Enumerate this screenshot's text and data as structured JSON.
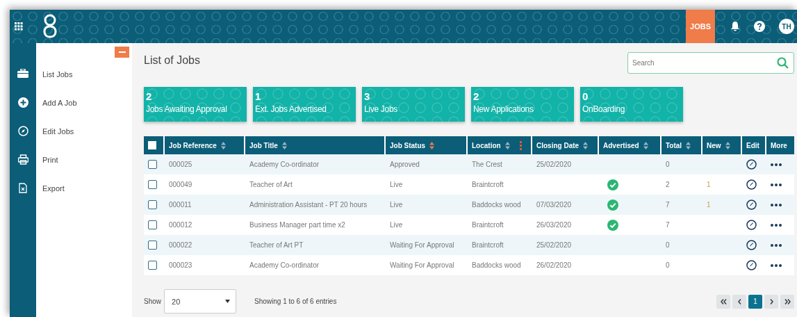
{
  "top_bar": {
    "active_module": {
      "label": "JOBS",
      "selected": true
    },
    "avatar": "TH"
  },
  "sidebar": {
    "items": [
      {
        "label": "List Jobs"
      },
      {
        "label": "Add A Job"
      },
      {
        "label": "Edit Jobs"
      },
      {
        "label": "Print"
      },
      {
        "label": "Export"
      }
    ]
  },
  "page_title": "List of Jobs",
  "search": {
    "placeholder": "Search"
  },
  "stats": [
    {
      "count": "2",
      "label": "Jobs Awaiting Approval"
    },
    {
      "count": "1",
      "label": "Ext. Jobs Advertised"
    },
    {
      "count": "3",
      "label": "Live Jobs"
    },
    {
      "count": "2",
      "label": "New Applications"
    },
    {
      "count": "0",
      "label": "OnBoarding"
    }
  ],
  "table": {
    "select_all": {
      "checked": false
    },
    "columns": [
      {
        "label": "Job Reference",
        "sortable": true,
        "sorted": false
      },
      {
        "label": "Job Title",
        "sortable": true,
        "sorted": false
      },
      {
        "label": "Job Status",
        "sortable": true,
        "sorted": true
      },
      {
        "label": "Location",
        "sortable": true,
        "sorted": false,
        "options": true
      },
      {
        "label": "Closing Date",
        "sortable": true,
        "sorted": false
      },
      {
        "label": "Advertised",
        "sortable": true,
        "sorted": false
      },
      {
        "label": "Total",
        "sortable": true,
        "sorted": false
      },
      {
        "label": "New",
        "sortable": true,
        "sorted": false
      },
      {
        "label": "Edit"
      },
      {
        "label": "More"
      }
    ],
    "rows": [
      {
        "checked": false,
        "reference": "000025",
        "title": "Academy Co-ordinator",
        "status": "Approved",
        "location": "The Crest",
        "closing_date": "25/02/2020",
        "advertised": false,
        "total": "0"
      },
      {
        "checked": false,
        "reference": "000049",
        "title": "Teacher of Art",
        "status": "Live",
        "location": "Braintcroft",
        "advertised": true,
        "total": "2",
        "new": "1"
      },
      {
        "checked": false,
        "reference": "000011",
        "title": "Administration Assistant - PT 20 hours",
        "status": "Live",
        "location": "Baddocks wood",
        "closing_date": "07/03/2020",
        "advertised": true,
        "total": "7",
        "new": "1"
      },
      {
        "checked": false,
        "reference": "000012",
        "title": "Business Manager part time x2",
        "status": "Live",
        "location": "Braintcroft",
        "closing_date": "26/03/2020",
        "advertised": true,
        "total": "7"
      },
      {
        "checked": false,
        "reference": "000022",
        "title": "Teacher of Art PT",
        "status": "Waiting For Approval",
        "location": "Braintcroft",
        "closing_date": "25/02/2020",
        "advertised": false,
        "total": "0"
      },
      {
        "checked": false,
        "reference": "000023",
        "title": "Academy Co-ordinator",
        "status": "Waiting For Approval",
        "location": "Baddocks wood",
        "closing_date": "26/02/2020",
        "advertised": false,
        "total": "0"
      }
    ]
  },
  "footer": {
    "show_label": "Show",
    "page_size": "20",
    "summary": "Showing 1 to 6 of 6 entries",
    "pages": [
      {
        "label": "1",
        "selected": true
      }
    ]
  }
}
